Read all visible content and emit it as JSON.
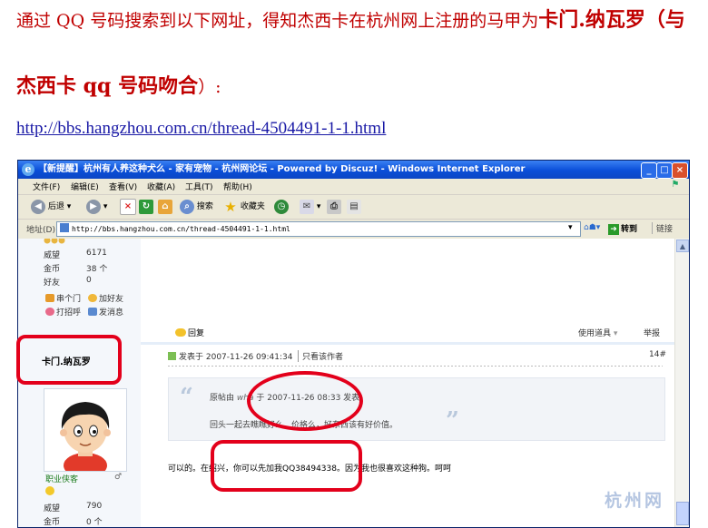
{
  "doc": {
    "line1_prefix": "通过 QQ 号码搜索到以下网址，得知杰西卡在杭州网上注册的马甲为",
    "line1_highlight": "卡门.纳瓦罗（与",
    "line2_highlight": "杰西卡 qq 号码吻合",
    "line2_suffix": "）:",
    "url": "http://bbs.hangzhou.com.cn/thread-4504491-1-1.html"
  },
  "window": {
    "title": "【新提醒】杭州有人养这种犬么 - 家有宠物 - 杭州网论坛 - Powered by Discuz! - Windows Internet Explorer",
    "minimize": "_",
    "maximize": "□",
    "close": "×"
  },
  "menu": {
    "file": "文件(F)",
    "edit": "编辑(E)",
    "view": "查看(V)",
    "favorites": "收藏(A)",
    "tools": "工具(T)",
    "help": "帮助(H)"
  },
  "toolbar": {
    "back": "后退",
    "search": "搜索",
    "favorites": "收藏夹"
  },
  "address": {
    "label": "地址(D)",
    "url": "http://bbs.hangzhou.com.cn/thread-4504491-1-1.html",
    "go": "转到",
    "links": "链接"
  },
  "sidebar": {
    "stats1": [
      {
        "label": "威望",
        "value": "6171"
      },
      {
        "label": "金币",
        "value": "38 个"
      },
      {
        "label": "好友",
        "value": "0"
      }
    ],
    "actions": {
      "visit": "串个门",
      "add_friend": "加好友",
      "greet": "打招呼",
      "message": "发消息"
    },
    "username": "卡门.纳瓦罗",
    "rank": "职业侠客",
    "stats2": [
      {
        "label": "威望",
        "value": "790"
      },
      {
        "label": "金币",
        "value": "0 个"
      }
    ]
  },
  "post": {
    "reply": "回复",
    "tools": "使用道具",
    "report": "举报",
    "posted_at": "发表于 2007-11-26 09:41:34",
    "only_author": "只看该作者",
    "floor": "14#",
    "quote_prefix": "原帖由",
    "quote_author": "wha",
    "quote_time": "于 2007-11-26 08:33 发表",
    "quote_text": "回头一起去瞧瞧好么。价格么，好东西该有好价值。",
    "body": "可以的。在绍兴，你可以先加我QQ38494338。因为我也很喜欢这种狗。呵呵"
  },
  "watermark": "杭州网"
}
